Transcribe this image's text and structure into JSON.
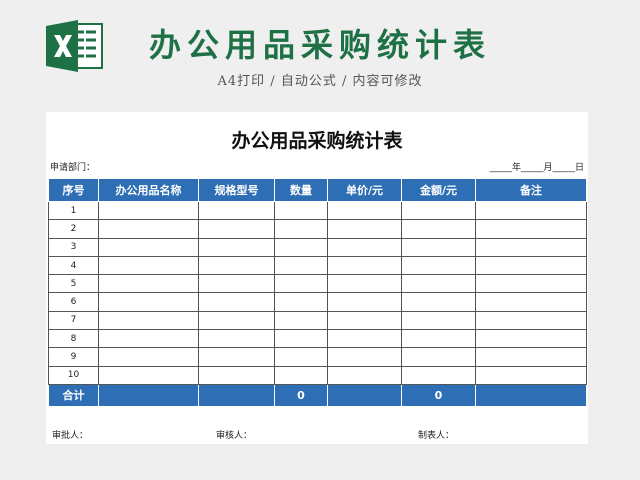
{
  "header": {
    "title": "办公用品采购统计表",
    "subtitle": "A4打印 / 自动公式 / 内容可修改",
    "icon": "excel-icon",
    "brand_color": "#1e7145"
  },
  "sheet": {
    "title": "办公用品采购统计表",
    "dept_label": "申请部门：",
    "date_label": "_____年_____月_____日",
    "accent_color": "#2e6eb5",
    "columns": [
      "序号",
      "办公用品名称",
      "规格型号",
      "数量",
      "单价/元",
      "金额/元",
      "备注"
    ],
    "rows": [
      "1",
      "2",
      "3",
      "4",
      "5",
      "6",
      "7",
      "8",
      "9",
      "10"
    ],
    "total": {
      "label": "合计",
      "quantity": "0",
      "amount": "0"
    },
    "signatures": {
      "approver": "审批人：",
      "reviewer": "审核人：",
      "preparer": "制表人："
    }
  }
}
